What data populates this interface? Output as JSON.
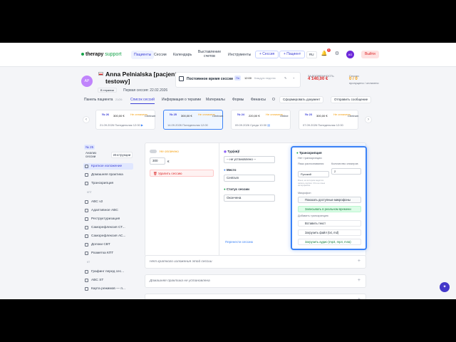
{
  "nav": {
    "logo_main": "therapy",
    "logo_sub": " support",
    "items": [
      "Пациенты",
      "Сессии",
      "Календарь",
      "Выставление счетов",
      "Инструменты"
    ],
    "session_btn": "+ Сессия",
    "patient_btn": "+ Пациент",
    "lang": "RU",
    "notif_count": "1",
    "avatar": "AG",
    "exit": "Выйти"
  },
  "patient": {
    "initials": "AP",
    "name": "Anna Pelnialska [pacjent testowy]",
    "tag": "В терапии",
    "first_session": "Первая сессия: 22.02.2026",
    "const_title": "Постоянное время сессии",
    "const_day": "Пн",
    "const_time": "12:00",
    "const_period": "Каждую неделю",
    "debt_label": "ЗАДОЛЖЕННОСТЬ",
    "debt_value": "4 140,00 €",
    "sessions_label": "Сессии",
    "sessions_value": "0 / 0",
    "sessions_sub": "пропущено / оплачено"
  },
  "tabs": {
    "items": [
      "Панель пациента",
      "Список сессий",
      "Информация о терапии",
      "Материалы",
      "Формы",
      "Финансы",
      "О"
    ],
    "count": "21/26",
    "doc_btn": "Сформировать документ",
    "msg_btn": "Отправить сообщение"
  },
  "sessions": [
    {
      "n": "№ 26",
      "price": "300,00 €",
      "status": "Не оплачено",
      "loc": "Centrum",
      "date": "21.09.2026",
      "day": "Понедельник",
      "time": "12:00"
    },
    {
      "n": "№ 25",
      "price": "300,00 €",
      "status": "Не оплачено",
      "loc": "Centrum",
      "date": "14.09.2026",
      "day": "Понедельник",
      "time": "12:00"
    },
    {
      "n": "№ 24",
      "price": "220,00 €",
      "status": "Не оплачено",
      "loc": "Online",
      "date": "09.09.2026",
      "day": "Среда",
      "time": "10:30"
    },
    {
      "n": "№ 23",
      "price": "300,00 €",
      "status": "Не оплачено",
      "loc": "Centrum",
      "date": "07.09.2026",
      "day": "Понедельник",
      "time": "12:00"
    }
  ],
  "sidebar": {
    "num": "№ 25",
    "title": "Анализ сессии",
    "instr": "Инструкции",
    "items": [
      "Краткое изложение",
      "Домашняя практика",
      "Транскрипция"
    ],
    "sect1": "КПТ",
    "items2": [
      "ABC v2",
      "Адаптивное ABC",
      "Реструктуризация",
      "Саморефлексия СТ...",
      "Саморефлексия АС...",
      "Допоки СВТ",
      "Разметка КПТ"
    ],
    "sect2": "КТ",
    "items3": [
      "Графинг перед сес...",
      "ABC ST",
      "Карта режимов — п..."
    ]
  },
  "session_form": {
    "paid": "Не оплачено",
    "amount": "300",
    "currency": "€",
    "delete": "Удалить сессию",
    "tags_label": "Тур(кв)/",
    "tags_value": "-- не установлено --",
    "place_label": "Место",
    "place_value": "Centrum",
    "status_label": "Статус сессии",
    "status_value": "Окончена",
    "move": "Перенести сессию"
  },
  "transcription": {
    "title": "Транскрипция",
    "subtitle": "Нет транскрипции",
    "lang_label": "Язык распознавания",
    "lang_value": "Русский",
    "spk_label": "Количество спикеров",
    "spk_value": "2",
    "note": "Язык, на котором ведётся запись сессии. Это не язык интерфейса.",
    "mic": "Микрофон",
    "show_mic": "Показать доступные микрофоны",
    "record": "Записывать в реальном времени",
    "add": "Добавить транскрипцию",
    "paste": "Вставить текст",
    "upload_file": "Загрузить файл (txt, md)",
    "upload_audio": "Загрузить аудио (mp3, mp4, m4a)"
  },
  "accordions": [
    "Нет краткого изложения этой сессии",
    "Домашняя практика не установлена",
    ""
  ],
  "colors": {
    "accent": "#3b3fd6",
    "brand": "#16a34a",
    "danger": "#dc2626",
    "warn": "#f59e0b"
  }
}
